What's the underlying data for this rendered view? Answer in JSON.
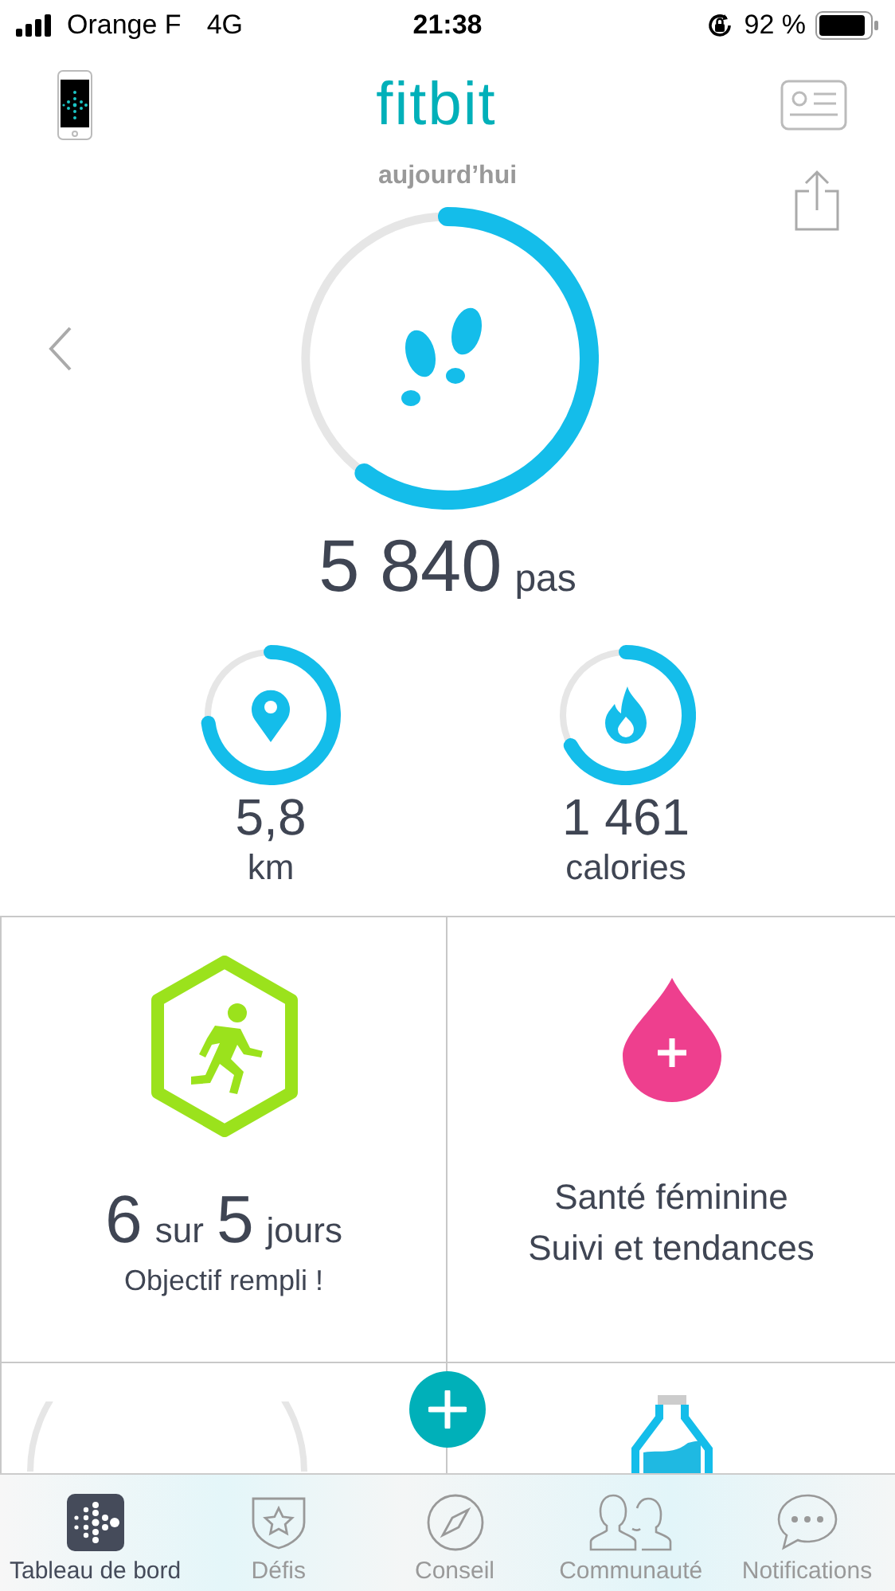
{
  "status_bar": {
    "carrier": "Orange F",
    "network": "4G",
    "time": "21:38",
    "battery": "92 %"
  },
  "header": {
    "logo": "fitbit"
  },
  "steps": {
    "date": "aujourd’hui",
    "value": "5 840",
    "unit": "pas"
  },
  "stats": [
    {
      "kind": "distance",
      "value": "5,8",
      "unit": "km"
    },
    {
      "kind": "calories",
      "value": "1 461",
      "unit": "calories"
    }
  ],
  "tiles": [
    {
      "kind": "exercise",
      "days_done": "6",
      "separator": "sur",
      "days_goal": "5",
      "unit": "jours",
      "subtitle": "Objectif rempli !"
    },
    {
      "kind": "female_health",
      "title": "Santé féminine",
      "subtitle": "Suivi et tendances"
    },
    {
      "kind": "sleep_ring"
    },
    {
      "kind": "water"
    }
  ],
  "tabs": [
    {
      "kind": "dashboard",
      "label": "Tableau de bord",
      "selected": true
    },
    {
      "kind": "challenges",
      "label": "Défis",
      "selected": false
    },
    {
      "kind": "guidance",
      "label": "Conseil",
      "selected": false
    },
    {
      "kind": "community",
      "label": "Communauté",
      "selected": false
    },
    {
      "kind": "notifications",
      "label": "Notifications",
      "selected": false
    }
  ]
}
